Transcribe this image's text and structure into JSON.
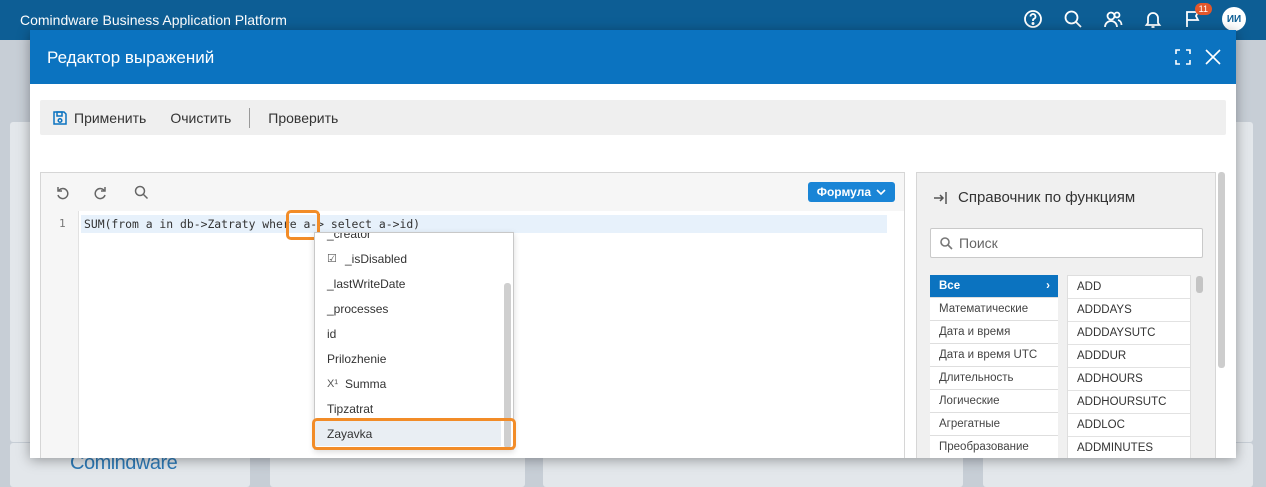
{
  "app": {
    "title": "Comindware Business Application Platform",
    "notifications_count": "11",
    "avatar_initials": "ИИ",
    "icons": [
      "help-icon",
      "search-icon",
      "users-icon",
      "bell-icon",
      "flag-icon"
    ]
  },
  "background": {
    "logo_text": "Comindware"
  },
  "modal": {
    "title": "Редактор выражений",
    "toolbar": {
      "apply_label": "Применить",
      "clear_label": "Очистить",
      "check_label": "Проверить"
    }
  },
  "editor": {
    "mode_label": "Формула",
    "line_number": "1",
    "code": "SUM(from a in db->Zatraty where a-> select a->id)"
  },
  "autocomplete": {
    "items": [
      {
        "label": "_creator",
        "icon": ""
      },
      {
        "label": "_isDisabled",
        "icon": "checkbox-icon"
      },
      {
        "label": "_lastWriteDate",
        "icon": ""
      },
      {
        "label": "_processes",
        "icon": ""
      },
      {
        "label": "id",
        "icon": ""
      },
      {
        "label": "Prilozhenie",
        "icon": ""
      },
      {
        "label": "Summa",
        "icon": "number-icon"
      },
      {
        "label": "Tipzatrat",
        "icon": ""
      },
      {
        "label": "Zayavka",
        "icon": "",
        "selected": true
      }
    ]
  },
  "reference": {
    "title": "Справочник по функциям",
    "search_placeholder": "Поиск",
    "categories": [
      "Все",
      "Математические",
      "Дата и время",
      "Дата и время UTC",
      "Длительность",
      "Логические",
      "Агрегатные",
      "Преобразование"
    ],
    "active_category": "Все",
    "functions": [
      "ADD",
      "ADDDAYS",
      "ADDDAYSUTC",
      "ADDDUR",
      "ADDHOURS",
      "ADDHOURSUTC",
      "ADDLOC",
      "ADDMINUTES"
    ]
  },
  "colors": {
    "appbar": "#0d5e95",
    "modal_header": "#0b73c0",
    "highlight": "#f28c28",
    "active_category": "#0b73c0"
  }
}
